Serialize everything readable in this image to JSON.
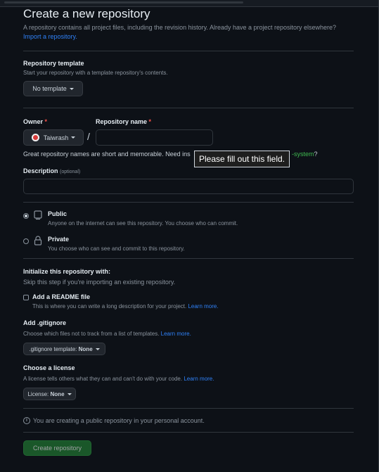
{
  "header": {
    "title": "Create a new repository",
    "subtitle": "A repository contains all project files, including the revision history. Already have a project repository elsewhere?",
    "import_link": "Import a repository."
  },
  "template": {
    "label": "Repository template",
    "desc": "Start your repository with a template repository's contents.",
    "button": "No template"
  },
  "owner": {
    "label": "Owner",
    "required": "*",
    "value": "Taiwrash"
  },
  "separator": "/",
  "repo_name": {
    "label": "Repository name",
    "required": "*",
    "value": ""
  },
  "hint": {
    "prefix": "Great repository names are short and memorable. Need ins",
    "suggestion_tail": "-system",
    "suffix": "?"
  },
  "tooltip": "Please fill out this field.",
  "description": {
    "label": "Description",
    "optional": "(optional)",
    "value": ""
  },
  "visibility": {
    "public_label": "Public",
    "public_desc": "Anyone on the internet can see this repository. You choose who can commit.",
    "private_label": "Private",
    "private_desc": "You choose who can see and commit to this repository.",
    "selected": "Public"
  },
  "init": {
    "heading": "Initialize this repository with:",
    "desc": "Skip this step if you're importing an existing repository.",
    "readme_label": "Add a README file",
    "readme_desc": "This is where you can write a long description for your project.",
    "readme_link": "Learn more.",
    "readme_checked": false
  },
  "gitignore": {
    "label": "Add .gitignore",
    "desc": "Choose which files not to track from a list of templates.",
    "link": "Learn more.",
    "button_prefix": ".gitignore template:",
    "button_value": "None"
  },
  "license": {
    "label": "Choose a license",
    "desc": "A license tells others what they can and can't do with your code.",
    "link": "Learn more.",
    "button_prefix": "License:",
    "button_value": "None"
  },
  "notice": "You are creating a public repository in your personal account.",
  "create_button": "Create repository",
  "colors": {
    "background": "#0d1117",
    "link": "#2f81f7",
    "primary_button": "#238636",
    "required": "#f85149",
    "suggestion": "#3fb950"
  }
}
